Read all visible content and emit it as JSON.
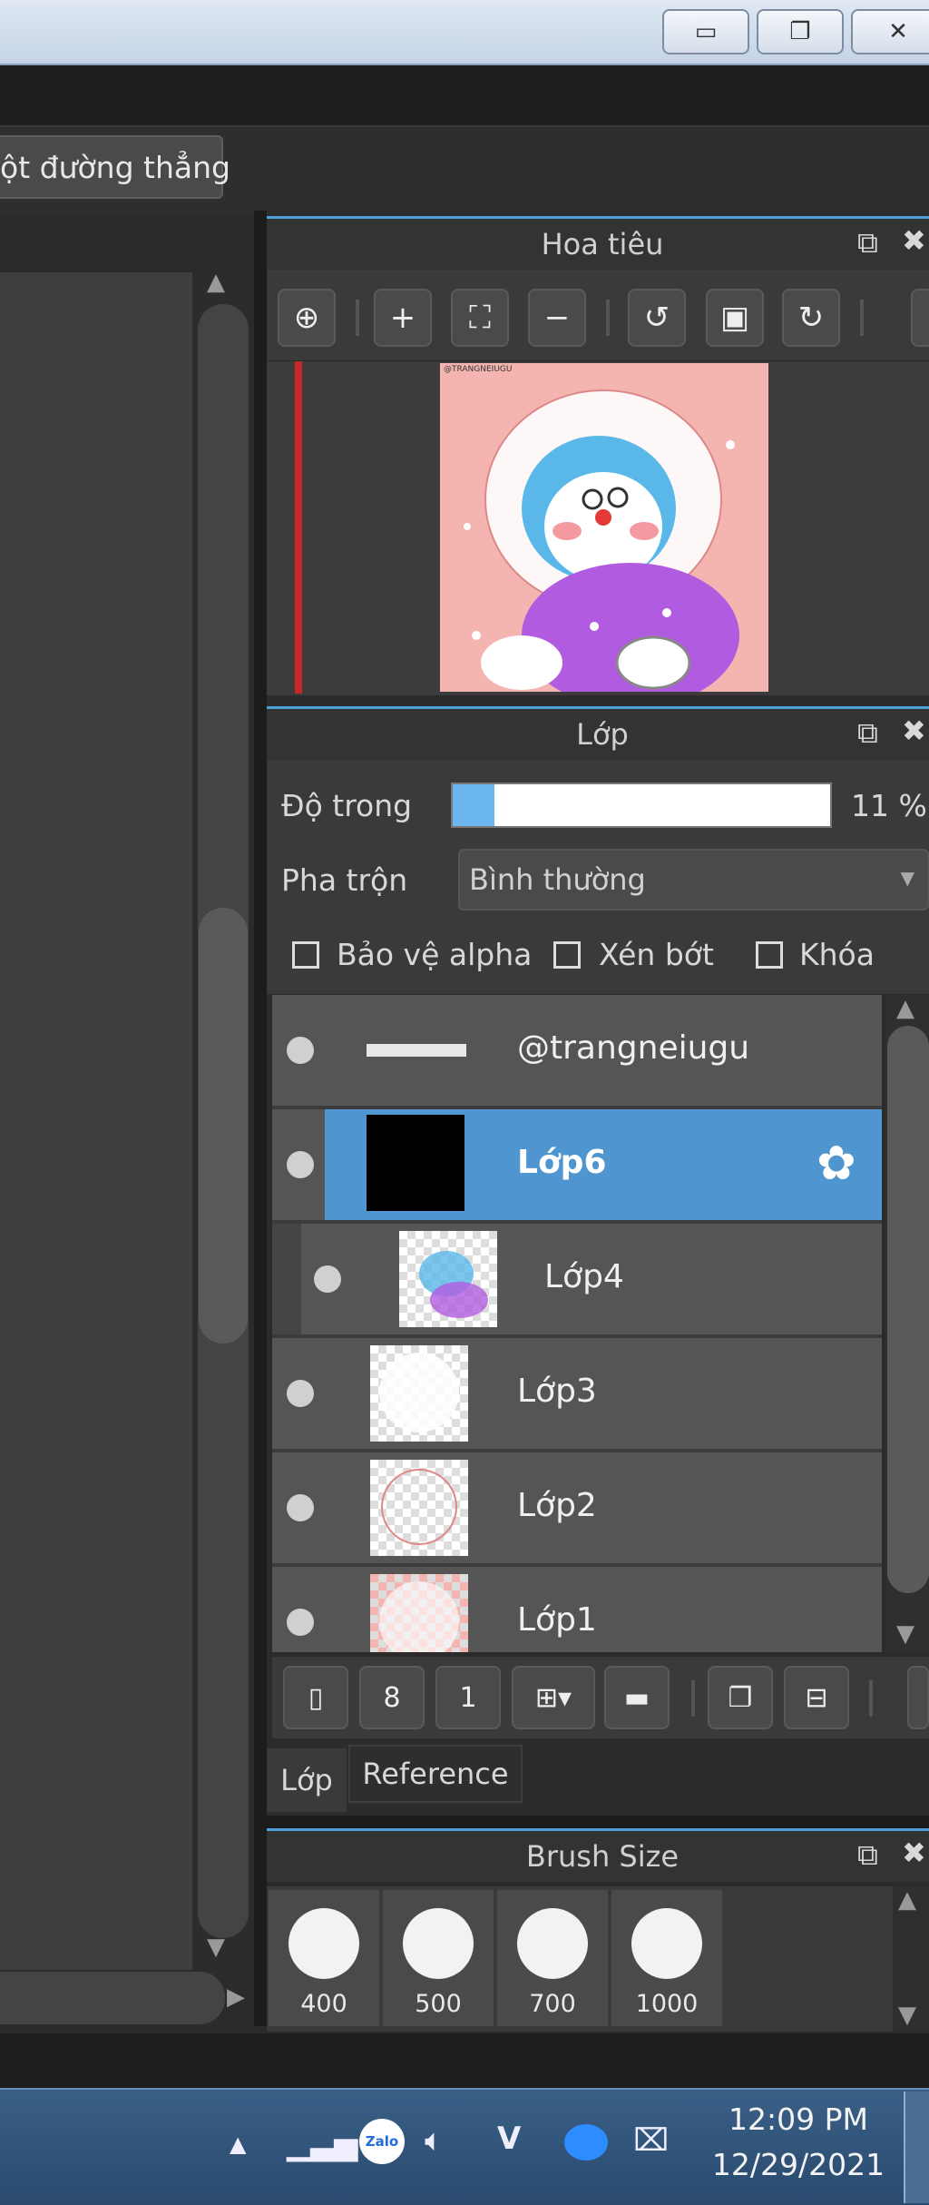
{
  "window": {
    "minimize_icon": "minimize-icon",
    "restore_icon": "restore-icon",
    "close_icon": "close-icon"
  },
  "toolbar": {
    "straight_line_label": "ột đường thẳng"
  },
  "navigator": {
    "title": "Hoa tiêu",
    "buttons": [
      "zoom-reset-icon",
      "zoom-in-icon",
      "fit-icon",
      "zoom-out-icon",
      "rotate-left-icon",
      "flip-icon",
      "rotate-right-icon"
    ],
    "artwork_signature": "@TRANGNEIUGU"
  },
  "layers": {
    "title": "Lớp",
    "opacity_label": "Độ trong",
    "opacity_value": "11 %",
    "opacity_fraction": 0.11,
    "blend_label": "Pha trộn",
    "blend_value": "Bình thường",
    "protect_alpha": "Bảo vệ alpha",
    "clipping": "Xén bớt",
    "lock": "Khóa",
    "items": [
      {
        "name": "@trangneiugu",
        "selected": false
      },
      {
        "name": "Lớp6",
        "selected": true
      },
      {
        "name": "Lớp4",
        "selected": false
      },
      {
        "name": "Lớp3",
        "selected": false
      },
      {
        "name": "Lớp2",
        "selected": false
      },
      {
        "name": "Lớp1",
        "selected": false
      }
    ]
  },
  "tabs": {
    "layer": "Lớp",
    "reference": "Reference"
  },
  "brush_size": {
    "title": "Brush Size",
    "sizes": [
      "400",
      "500",
      "700",
      "1000"
    ]
  },
  "taskbar": {
    "time": "12:09 PM",
    "date": "12/29/2021",
    "v_label": "V"
  },
  "colors": {
    "accent": "#4ea0d8",
    "selected_layer": "#4f95d0",
    "opacity_fill": "#6cb7ef"
  }
}
